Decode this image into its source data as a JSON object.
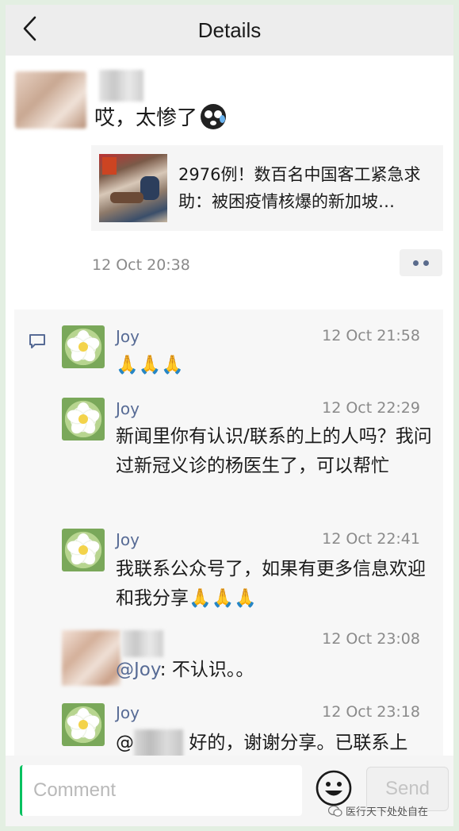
{
  "header": {
    "title": "Details"
  },
  "post": {
    "text": "哎，太惨了",
    "link_title": "2976例！数百名中国客工紧急求助：被困疫情核爆的新加坡…",
    "time": "12 Oct 20:38"
  },
  "comments": [
    {
      "name": "Joy",
      "time": "12 Oct 21:58",
      "text": "🙏🙏🙏"
    },
    {
      "name": "Joy",
      "time": "12 Oct 22:29",
      "text": "新闻里你有认识/联系的上的人吗？我问过新冠义诊的杨医生了，可以帮忙"
    },
    {
      "name": "Joy",
      "time": "12 Oct 22:41",
      "text": "我联系公众号了，如果有更多信息欢迎和我分享🙏🙏🙏"
    },
    {
      "name": "",
      "time": "12 Oct 23:08",
      "mention": "@Joy",
      "text": ": 不认识。。"
    },
    {
      "name": "Joy",
      "time": "12 Oct 23:18",
      "mention": "@",
      "text": "好的，谢谢分享。已联系上"
    }
  ],
  "bottom": {
    "placeholder": "Comment",
    "send_label": "Send"
  },
  "watermark": "医行天下处处自在",
  "colors": {
    "link_blue": "#576b95",
    "accent_green": "#07c160"
  },
  "icons": [
    "back-arrow-icon",
    "comment-bubble-icon",
    "smiley-icon",
    "shock-emoji-icon"
  ]
}
